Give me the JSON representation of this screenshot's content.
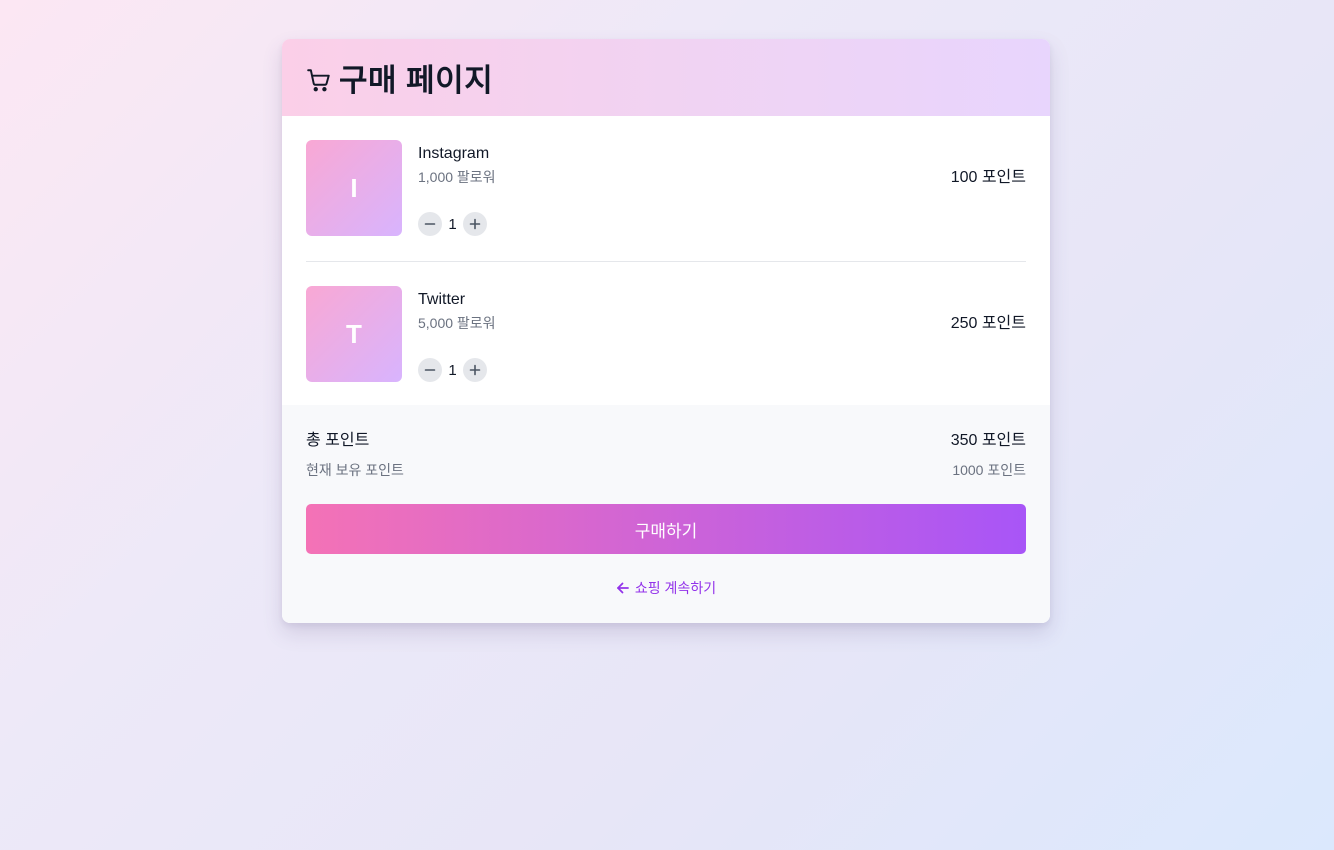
{
  "header": {
    "title": "구매 페이지",
    "icon": "shopping-cart-icon"
  },
  "items": [
    {
      "initial": "I",
      "name": "Instagram",
      "detail": "1,000 팔로워",
      "quantity": "1",
      "price": "100 포인트"
    },
    {
      "initial": "T",
      "name": "Twitter",
      "detail": "5,000 팔로워",
      "quantity": "1",
      "price": "250 포인트"
    }
  ],
  "summary": {
    "total_label": "총 포인트",
    "total_value": "350 포인트",
    "owned_label": "현재 보유 포인트",
    "owned_value": "1000 포인트"
  },
  "actions": {
    "buy_label": "구매하기",
    "continue_label": "쇼핑 계속하기"
  },
  "colors": {
    "accent_start": "#f472b6",
    "accent_end": "#a855f7",
    "link": "#9333ea"
  }
}
